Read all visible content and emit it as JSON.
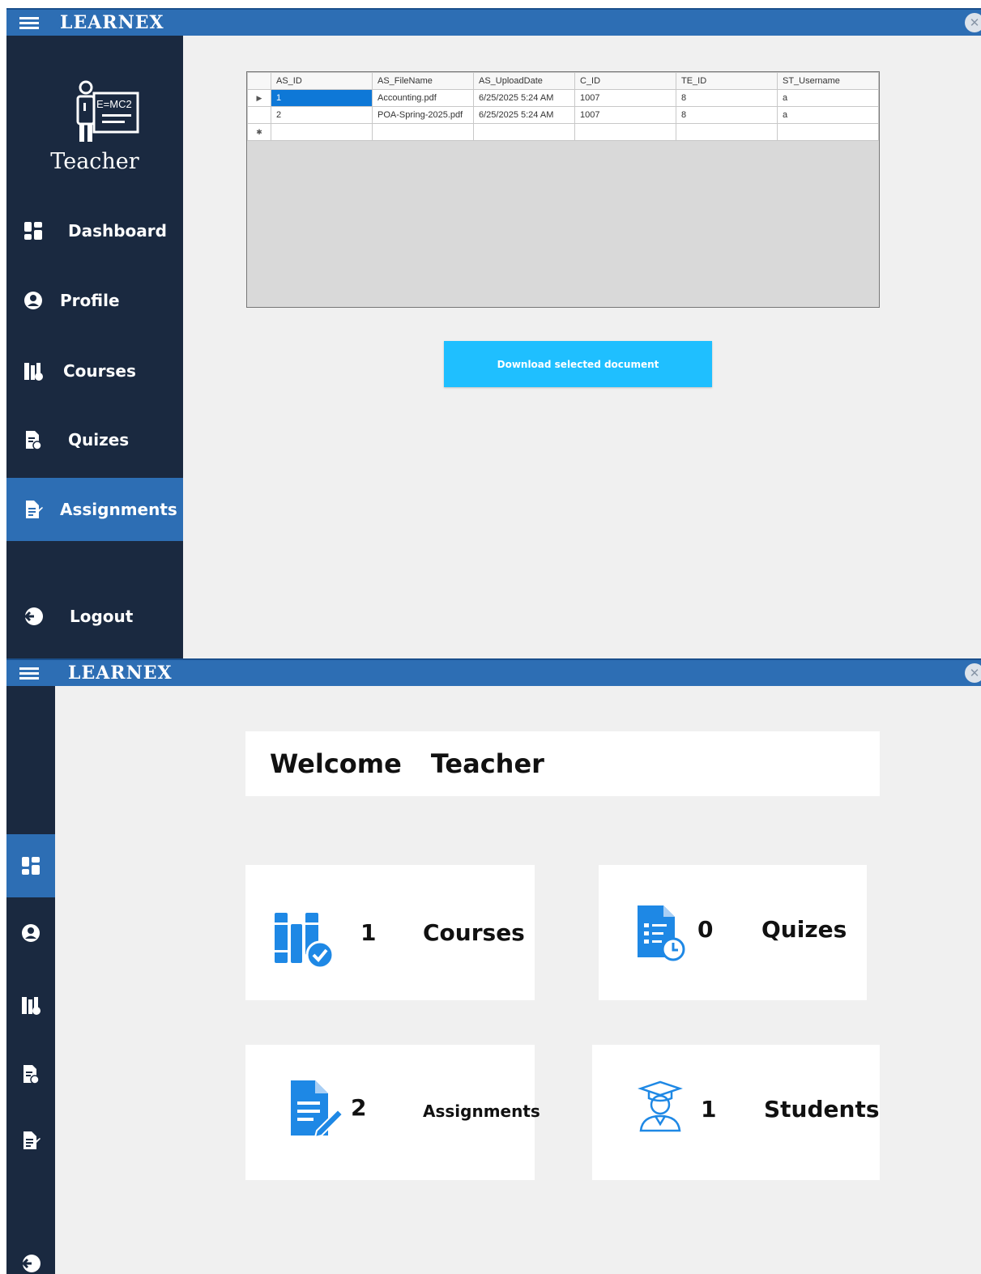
{
  "app": {
    "brand": "LEARNEX"
  },
  "sidebar": {
    "logo_text": "E=MC2",
    "role": "Teacher",
    "items": [
      {
        "label": "Dashboard"
      },
      {
        "label": "Profile"
      },
      {
        "label": "Courses"
      },
      {
        "label": "Quizes"
      },
      {
        "label": "Assignments"
      },
      {
        "label": "Logout"
      }
    ]
  },
  "assignments": {
    "columns": [
      "AS_ID",
      "AS_FileName",
      "AS_UploadDate",
      "C_ID",
      "TE_ID",
      "ST_Username"
    ],
    "rows": [
      [
        "1",
        "Accounting.pdf",
        "6/25/2025 5:24 AM",
        "1007",
        "8",
        "a"
      ],
      [
        "2",
        "POA-Spring-2025.pdf",
        "6/25/2025 5:24 AM",
        "1007",
        "8",
        "a"
      ]
    ],
    "download_label": "Download selected document"
  },
  "dashboard": {
    "welcome_word": "Welcome",
    "welcome_name": "Teacher",
    "cards": {
      "courses": {
        "count": "1",
        "label": "Courses"
      },
      "quizes": {
        "count": "0",
        "label": "Quizes"
      },
      "assignments": {
        "count": "2",
        "label": "Assignments"
      },
      "students": {
        "count": "1",
        "label": "Students"
      }
    }
  },
  "colors": {
    "sidebar": "#1a2940",
    "accent": "#2d6eb4",
    "button": "#1fbfff",
    "icon": "#1e88e5"
  }
}
